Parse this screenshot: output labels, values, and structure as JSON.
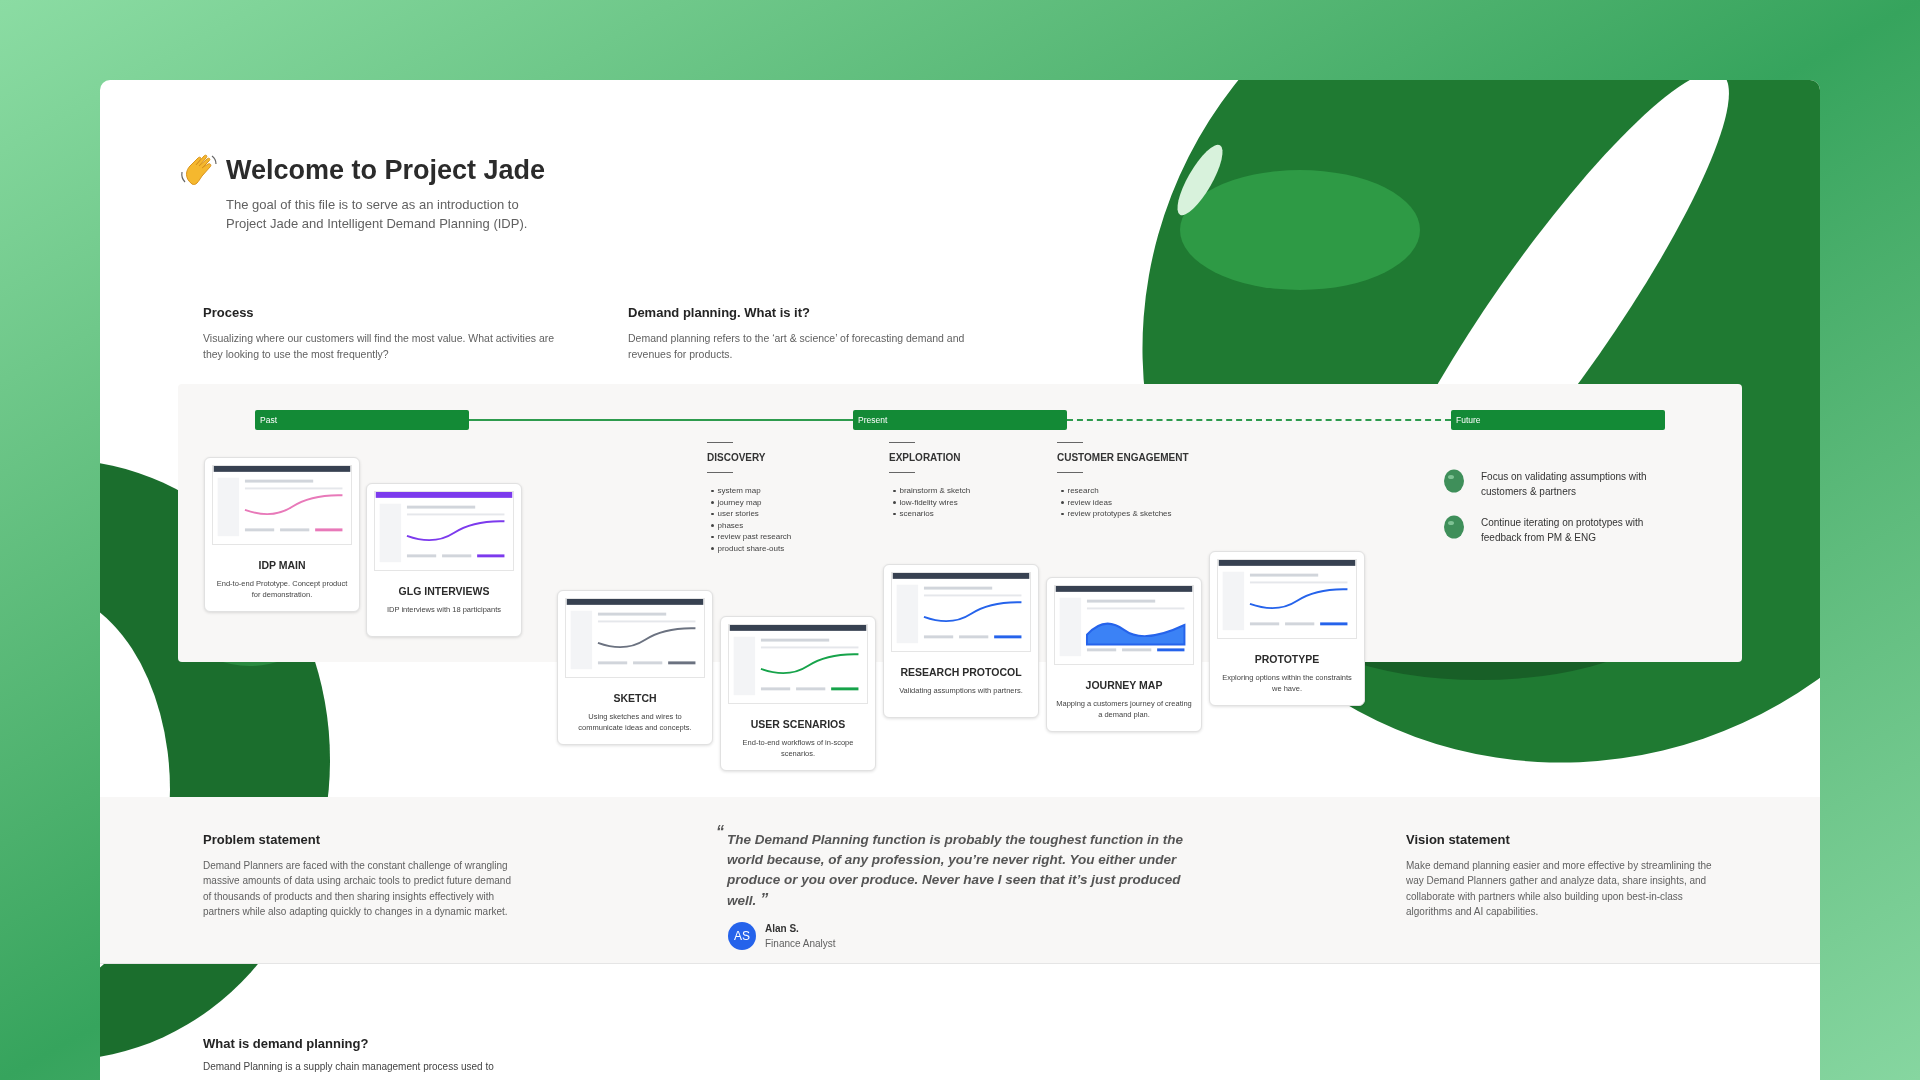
{
  "header": {
    "title": "Welcome to Project Jade",
    "subtitle": "The goal of this file is to serve as an introduction to Project Jade and Intelligent Demand Planning (IDP)."
  },
  "intro_sections": [
    {
      "heading": "Process",
      "text": "Visualizing where our customers will find the most value. What activities are they looking to use the most frequently?"
    },
    {
      "heading": "Demand planning. What is it?",
      "text": "Demand planning refers to the ‘art & science’ of forecasting demand and revenues for products."
    }
  ],
  "timeline": {
    "phases": [
      {
        "label": "Past",
        "dashed_line_after": false
      },
      {
        "label": "Present",
        "dashed_line_after": true
      },
      {
        "label": "Future"
      }
    ]
  },
  "cards": [
    {
      "title": "IDP MAIN",
      "text": "End-to-end Prototype. Concept product for demonstration."
    },
    {
      "title": "GLG INTERVIEWS",
      "text": "IDP interviews with 18 participants"
    },
    {
      "title": "SKETCH",
      "text": "Using sketches and wires to communicate ideas and concepts."
    },
    {
      "title": "USER SCENARIOS",
      "text": "End-to-end workflows of in-scope scenarios."
    },
    {
      "title": "RESEARCH PROTOCOL",
      "text": "Validating assumptions with partners."
    },
    {
      "title": "JOURNEY MAP",
      "text": "Mapping a customers journey of creating a demand plan."
    },
    {
      "title": "PROTOTYPE",
      "text": "Exploring options within the constraints we have."
    }
  ],
  "activity_columns": [
    {
      "heading": "DISCOVERY",
      "items": [
        "system map",
        "journey map",
        "user stories",
        "phases",
        "review past research",
        "product share-outs"
      ]
    },
    {
      "heading": "EXPLORATION",
      "items": [
        "brainstorm & sketch",
        "low-fidelity wires",
        "scenarios"
      ]
    },
    {
      "heading": "CUSTOMER ENGAGEMENT",
      "items": [
        "research",
        "review ideas",
        "review prototypes & sketches"
      ]
    }
  ],
  "future_notes": [
    "Focus on validating assumptions with customers & partners",
    "Continue iterating on prototypes with feedback from PM & ENG"
  ],
  "problem_statement": {
    "heading": "Problem statement",
    "text": "Demand Planners are faced with the constant challenge of wrangling massive amounts of data using archaic tools to predict future demand of thousands of products and then sharing insights effectively with partners while also adapting quickly to changes in a dynamic market."
  },
  "quote": {
    "open_mark": "“",
    "text": "The Demand Planning function is probably the toughest function in the world because, of any profession, you’re never right. You either under produce or you over produce. Never have I seen that it’s just produced well.",
    "close_mark": "”",
    "initials": "AS",
    "name": "Alan S.",
    "role": "Finance Analyst"
  },
  "vision_statement": {
    "heading": "Vision statement",
    "text": "Make demand planning easier and more effective by streamlining the way Demand Planners gather and analyze data, share insights, and collaborate with partners while also building upon best-in-class algorithms and AI capabilities."
  },
  "what_is": {
    "heading": "What is demand planning?",
    "text": "Demand Planning is a supply chain management process used to"
  }
}
